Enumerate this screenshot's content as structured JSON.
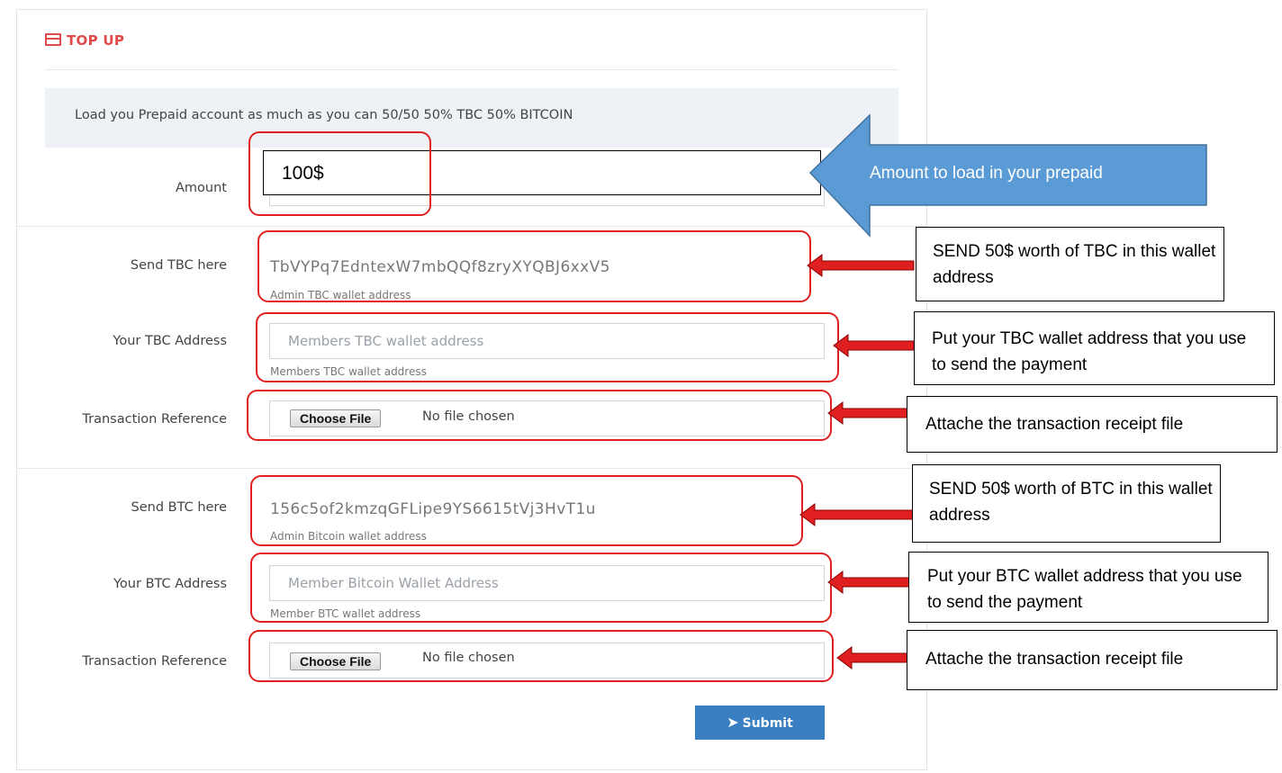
{
  "header": {
    "title": "TOP UP",
    "icon": "card-icon"
  },
  "notice": "Load you Prepaid account as much as you can 50/50 50% TBC 50% BITCOIN",
  "form": {
    "amount_label": "Amount",
    "amount_value": "100$",
    "send_tbc_label": "Send TBC here",
    "tbc_address": "TbVYPq7EdntexW7mbQQf8zryXYQBJ6xxV5",
    "tbc_help": "Admin TBC wallet address",
    "your_tbc_label": "Your TBC Address",
    "your_tbc_placeholder": "Members TBC wallet address",
    "your_tbc_help": "Members TBC wallet address",
    "tx_ref_label": "Transaction Reference",
    "choose_file": "Choose File",
    "no_file": "No file chosen",
    "send_btc_label": "Send BTC here",
    "btc_address": "156c5of2kmzqGFLipe9YS6615tVj3HvT1u",
    "btc_help": "Admin Bitcoin wallet address",
    "your_btc_label": "Your BTC Address",
    "your_btc_placeholder": "Member Bitcoin Wallet Address",
    "your_btc_help": "Member BTC wallet address",
    "submit": "Submit"
  },
  "annotations": {
    "amount": "Amount to load in your prepaid",
    "send_tbc": "SEND 50$ worth of TBC in this wallet address",
    "your_tbc": "Put your TBC wallet address that you use to send the payment",
    "attach1": "Attache the transaction receipt file",
    "send_btc": "SEND 50$ worth of BTC in this wallet address",
    "your_btc": "Put your BTC wallet address that you use to send the payment",
    "attach2": "Attache the transaction receipt file"
  },
  "colors": {
    "accent_red": "#e04a4a",
    "button_blue": "#3a7fc1",
    "callout_blue": "#5b9bd5",
    "annotation_red": "#e02020"
  }
}
